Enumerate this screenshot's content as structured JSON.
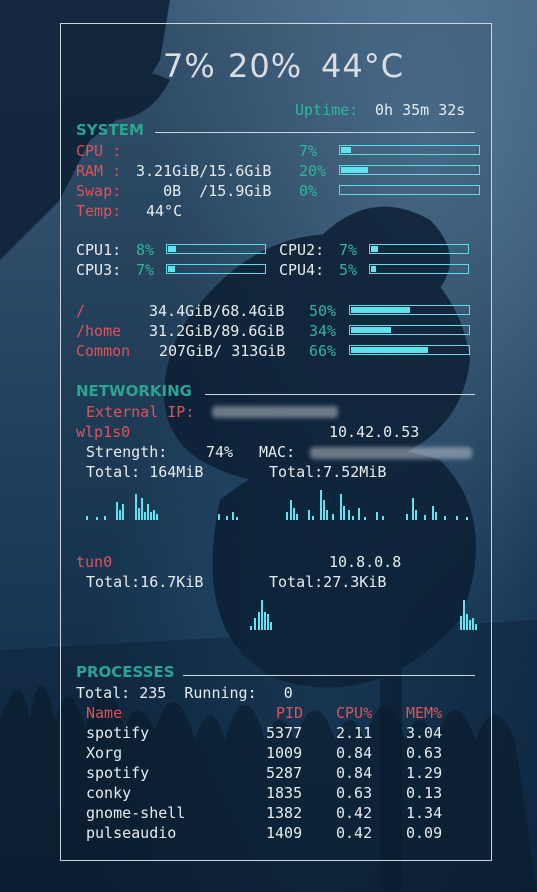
{
  "header": {
    "cpu": "7%",
    "mem": "20%",
    "temp": "44°C"
  },
  "uptime": {
    "label": "Uptime:",
    "value": "0h 35m 32s"
  },
  "system": {
    "title": "SYSTEM",
    "cpu_label": "CPU :",
    "cpu_pct": "7%",
    "cpu_frac": 0.07,
    "ram_label": "RAM :",
    "ram_val": "3.21GiB/15.6GiB",
    "ram_pct": "20%",
    "ram_frac": 0.2,
    "swap_label": "Swap:",
    "swap_val": "   0B  /15.9GiB",
    "swap_pct": "0%",
    "swap_frac": 0.0,
    "temp_label": "Temp:",
    "temp_val": "44°C",
    "cores": [
      {
        "label": "CPU1:",
        "pct": "8%",
        "frac": 0.08
      },
      {
        "label": "CPU2:",
        "pct": "7%",
        "frac": 0.07
      },
      {
        "label": "CPU3:",
        "pct": "7%",
        "frac": 0.07
      },
      {
        "label": "CPU4:",
        "pct": "5%",
        "frac": 0.05
      }
    ],
    "disks": [
      {
        "label": "/",
        "val": "34.4GiB/68.4GiB",
        "pct": "50%",
        "frac": 0.5
      },
      {
        "label": "/home",
        "val": "31.2GiB/89.6GiB",
        "pct": "34%",
        "frac": 0.34
      },
      {
        "label": "Common",
        "val": "207GiB/ 313GiB",
        "pct": "66%",
        "frac": 0.66
      }
    ]
  },
  "networking": {
    "title": "NETWORKING",
    "external_ip_label": "External IP:",
    "iface1": {
      "name": "wlp1s0",
      "ip": "10.42.0.53",
      "strength_label": "Strength:",
      "strength": "74%",
      "mac_label": "MAC:",
      "total_down": "Total: 164MiB",
      "total_up": "Total:7.52MiB"
    },
    "iface2": {
      "name": "tun0",
      "ip": "10.8.0.8",
      "total_down": "Total:16.7KiB",
      "total_up": "Total:27.3KiB"
    }
  },
  "processes": {
    "title": "PROCESSES",
    "total_line": "Total: 235  Running:   0",
    "columns": {
      "name": "Name",
      "pid": "PID",
      "cpu": "CPU%",
      "mem": "MEM%"
    },
    "rows": [
      {
        "name": "spotify",
        "pid": "5377",
        "cpu": "2.11",
        "mem": "3.04"
      },
      {
        "name": "Xorg",
        "pid": "1009",
        "cpu": "0.84",
        "mem": "0.63"
      },
      {
        "name": "spotify",
        "pid": "5287",
        "cpu": "0.84",
        "mem": "1.29"
      },
      {
        "name": "conky",
        "pid": "1835",
        "cpu": "0.63",
        "mem": "0.13"
      },
      {
        "name": "gnome-shell",
        "pid": "1382",
        "cpu": "0.42",
        "mem": "1.34"
      },
      {
        "name": "pulseaudio",
        "pid": "1409",
        "cpu": "0.42",
        "mem": "0.09"
      }
    ]
  },
  "colors": {
    "accent": "#2aa592",
    "label_red": "#e0525a",
    "bar_cyan": "#5fe3ef"
  }
}
